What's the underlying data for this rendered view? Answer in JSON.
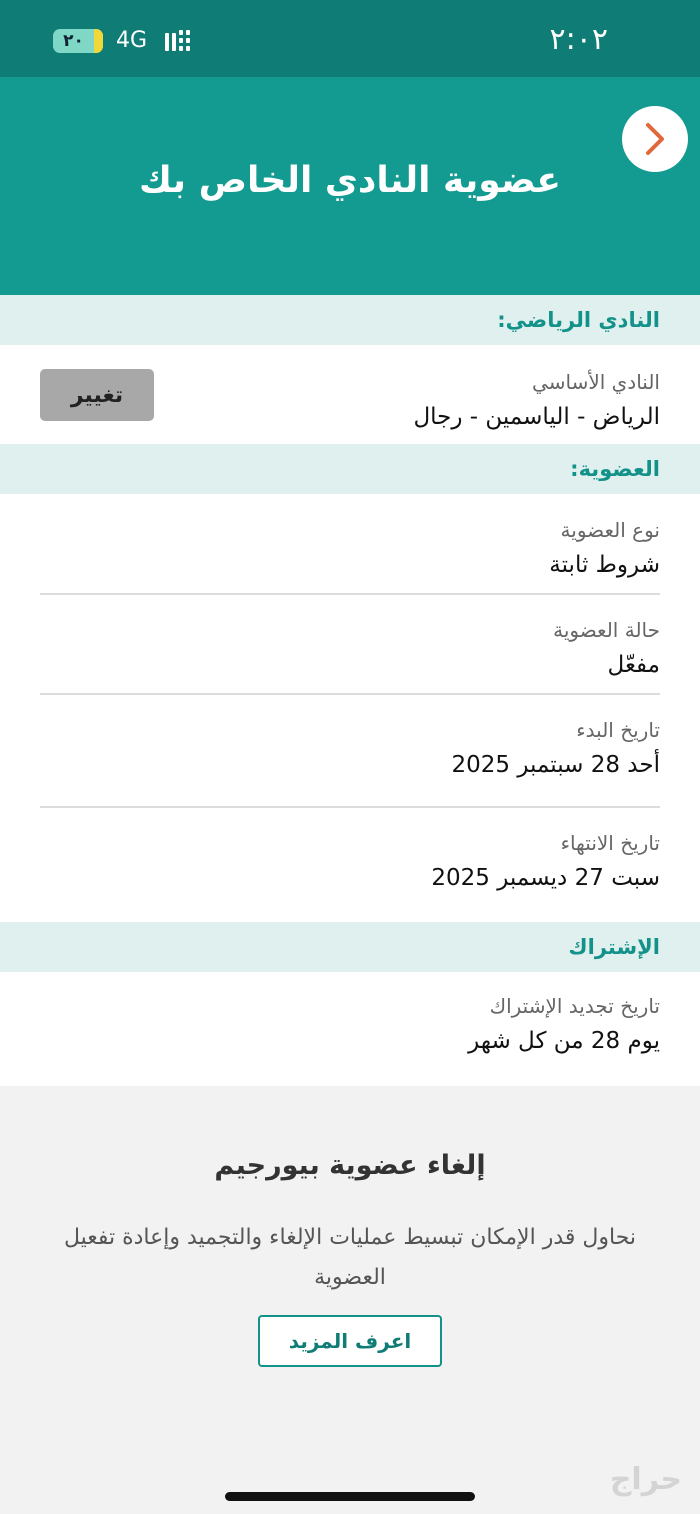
{
  "status_bar": {
    "time": "٢:٠٢",
    "battery": "٢٠",
    "network": "4G"
  },
  "header": {
    "title": "عضوية النادي الخاص بك"
  },
  "sports_club": {
    "heading": "النادي الرياضي:",
    "primary_club_label": "النادي الأساسي",
    "primary_club_value": "الرياض - الياسمين - رجال",
    "change_label": "تغيير"
  },
  "membership": {
    "heading": "العضوية:",
    "fields": [
      {
        "label": "نوع العضوية",
        "value": "شروط ثابتة"
      },
      {
        "label": "حالة العضوية",
        "value": "مفعّل"
      },
      {
        "label": "تاريخ البدء",
        "value": "أحد 28 سبتمبر 2025"
      },
      {
        "label": "تاريخ الانتهاء",
        "value": "سبت 27 ديسمبر 2025"
      }
    ]
  },
  "subscription": {
    "heading": "الإشتراك",
    "renewal_label": "تاريخ تجديد الإشتراك",
    "renewal_value": "يوم 28 من كل شهر"
  },
  "cancel": {
    "title": "إلغاء عضوية بيورجيم",
    "description": "نحاول قدر الإمكان تبسيط عمليات الإلغاء والتجميد وإعادة تفعيل العضوية",
    "button_label": "اعرف المزيد"
  },
  "watermark": "حراج",
  "colors": {
    "header": "#139a91",
    "status_bar": "#0f7d76",
    "accent": "#13928a",
    "section_bg": "#dff0ef"
  }
}
